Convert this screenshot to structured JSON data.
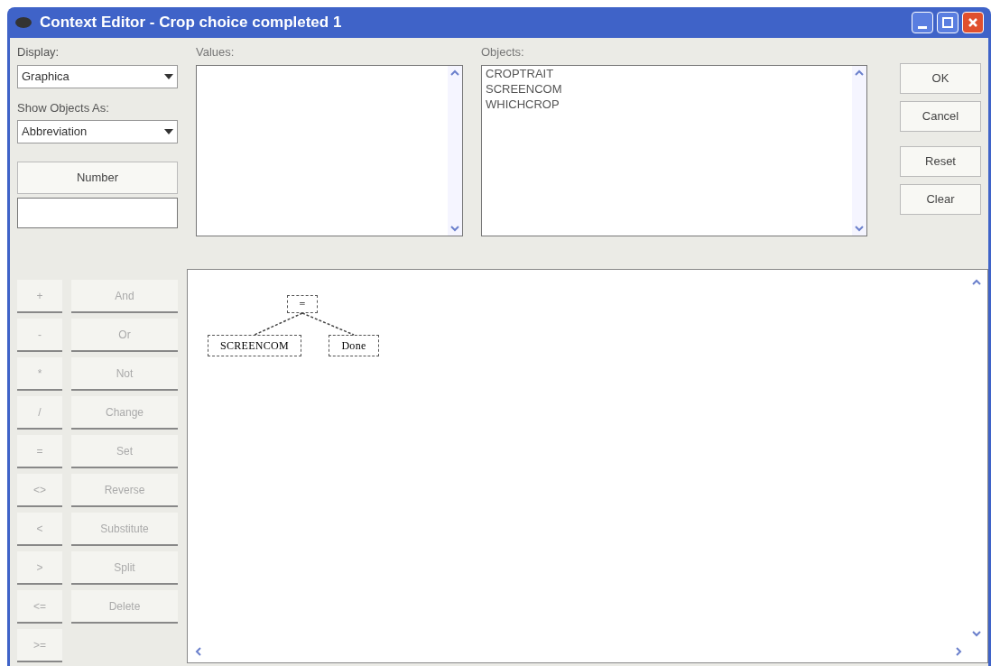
{
  "window": {
    "title": "Context Editor - Crop choice completed 1"
  },
  "display": {
    "label": "Display:",
    "value": "Graphica"
  },
  "show_objects_as": {
    "label": "Show Objects As:",
    "value": "Abbreviation"
  },
  "number_button": "Number",
  "values": {
    "label": "Values:"
  },
  "objects": {
    "label": "Objects:",
    "items": [
      "CROPTRAIT",
      "SCREENCOM",
      "WHICHCROP"
    ]
  },
  "buttons": [
    {
      "label": "OK",
      "disabled": false
    },
    {
      "label": "Cancel",
      "disabled": false
    },
    {
      "label": "Reset",
      "disabled": false
    },
    {
      "label": "Clear",
      "disabled": false
    }
  ],
  "operators": [
    {
      "symbol": "+",
      "action": "And"
    },
    {
      "symbol": "-",
      "action": "Or"
    },
    {
      "symbol": "*",
      "action": "Not"
    },
    {
      "symbol": "/",
      "action": "Change"
    },
    {
      "symbol": "=",
      "action": "Set"
    },
    {
      "symbol": "<>",
      "action": "Reverse"
    },
    {
      "symbol": "<",
      "action": "Substitute"
    },
    {
      "symbol": ">",
      "action": "Split"
    },
    {
      "symbol": "<=",
      "action": "Delete"
    },
    {
      "symbol": ">="
    }
  ],
  "tree": {
    "label": "=",
    "children": [
      {
        "label": "SCREENCOM"
      },
      {
        "label": "Done"
      }
    ]
  }
}
